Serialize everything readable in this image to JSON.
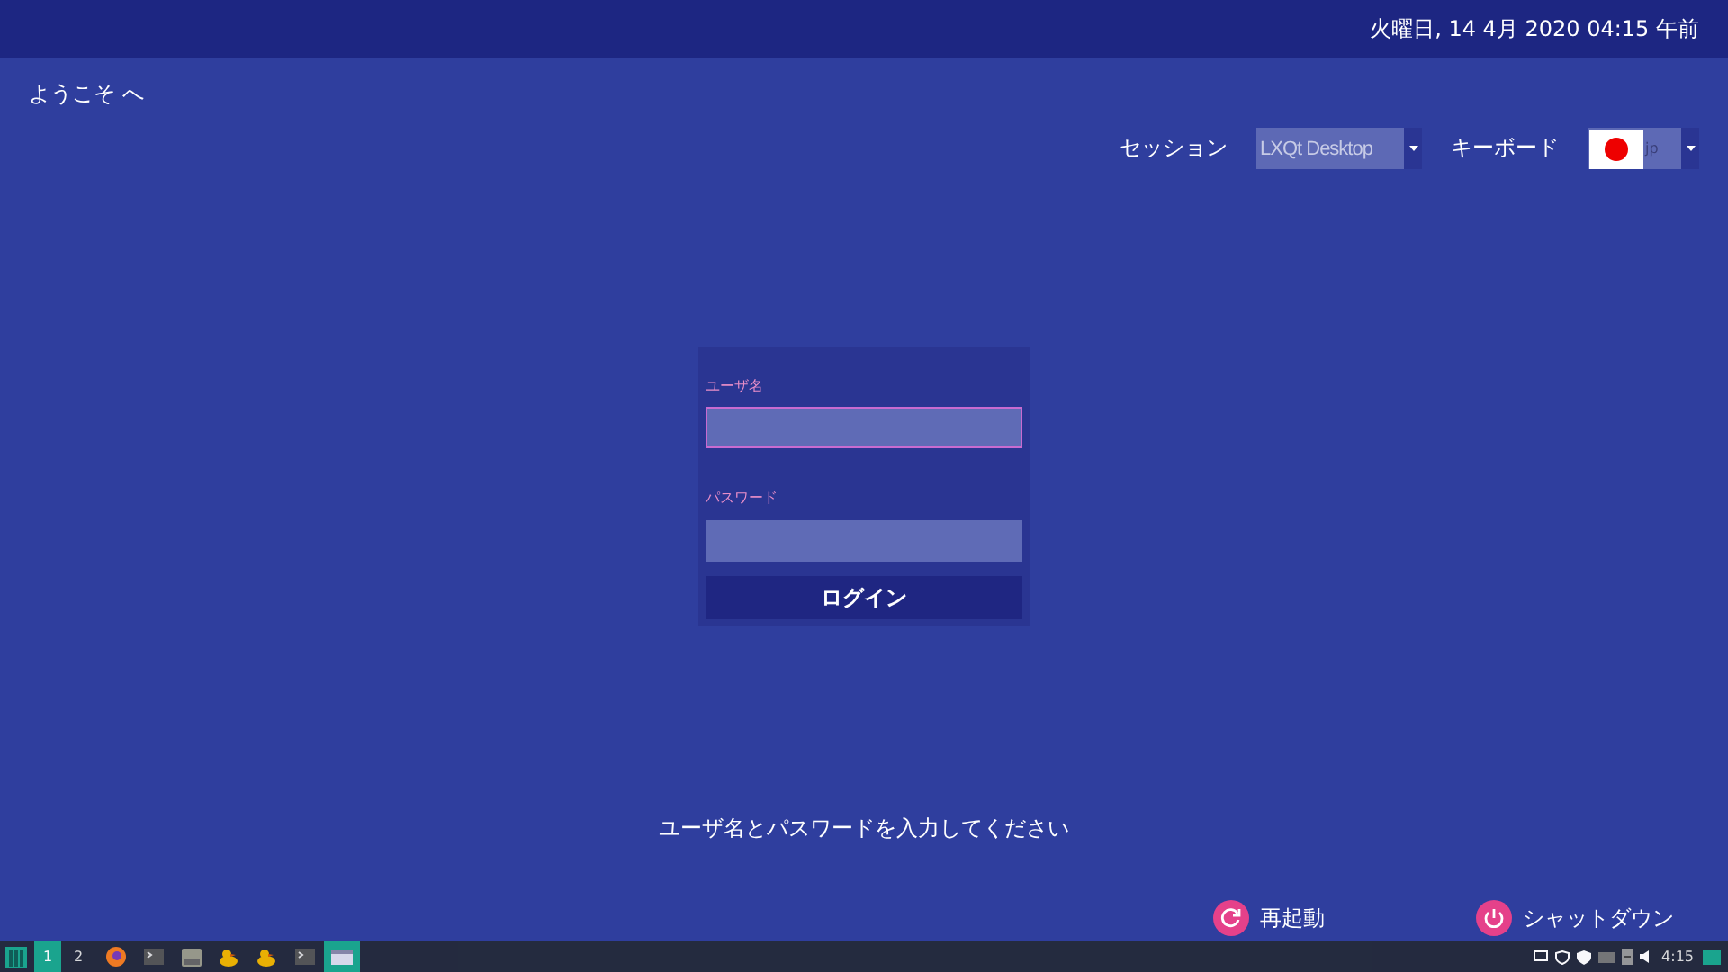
{
  "top_bar": {
    "date_time": "火曜日, 14 4月 2020 04:15 午前"
  },
  "welcome": "ようこそ へ",
  "session": {
    "label": "セッション",
    "value": "LXQt Desktop"
  },
  "keyboard": {
    "label": "キーボード",
    "value": "jp"
  },
  "login": {
    "username_label": "ユーザ名",
    "username_focused": true,
    "password_label": "パスワード",
    "button": "ログイン"
  },
  "prompt": "ユーザ名とパスワードを入力してください",
  "power_buttons": [
    {
      "kind": "restart",
      "label": "再起動"
    },
    {
      "kind": "shutdown",
      "label": "シャットダウン"
    }
  ],
  "taskbar": {
    "workspaces": [
      {
        "label": "1",
        "selected": true
      },
      {
        "label": "2",
        "selected": false
      }
    ],
    "apps": [
      {
        "kind": "browser",
        "active": false
      },
      {
        "kind": "terminal",
        "active": false
      },
      {
        "kind": "drive",
        "active": false
      },
      {
        "kind": "duck",
        "active": false
      },
      {
        "kind": "duck",
        "active": false
      },
      {
        "kind": "terminal",
        "active": false
      },
      {
        "kind": "window",
        "active": true
      }
    ],
    "clock": "4:15"
  }
}
